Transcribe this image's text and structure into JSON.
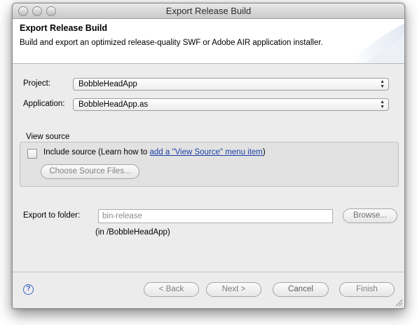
{
  "window": {
    "title": "Export Release Build"
  },
  "header": {
    "title": "Export Release Build",
    "description": "Build and export an optimized release-quality SWF or Adobe AIR application installer."
  },
  "form": {
    "project_label": "Project:",
    "project_value": "BobbleHeadApp",
    "application_label": "Application:",
    "application_value": "BobbleHeadApp.as"
  },
  "view_source": {
    "group_label": "View source",
    "include_text_before": "Include source (Learn how to ",
    "link_text": "add a \"View Source\" menu item",
    "include_text_after": ")",
    "include_checked": false,
    "choose_button": "Choose Source Files..."
  },
  "export": {
    "label": "Export to folder:",
    "value": "bin-release",
    "browse_button": "Browse...",
    "hint": "(in /BobbleHeadApp)"
  },
  "buttons": {
    "back": "< Back",
    "next": "Next >",
    "cancel": "Cancel",
    "finish": "Finish"
  },
  "icons": {
    "help": "?"
  },
  "colors": {
    "link": "#1b3fa8",
    "help_icon": "#3a64c4"
  }
}
